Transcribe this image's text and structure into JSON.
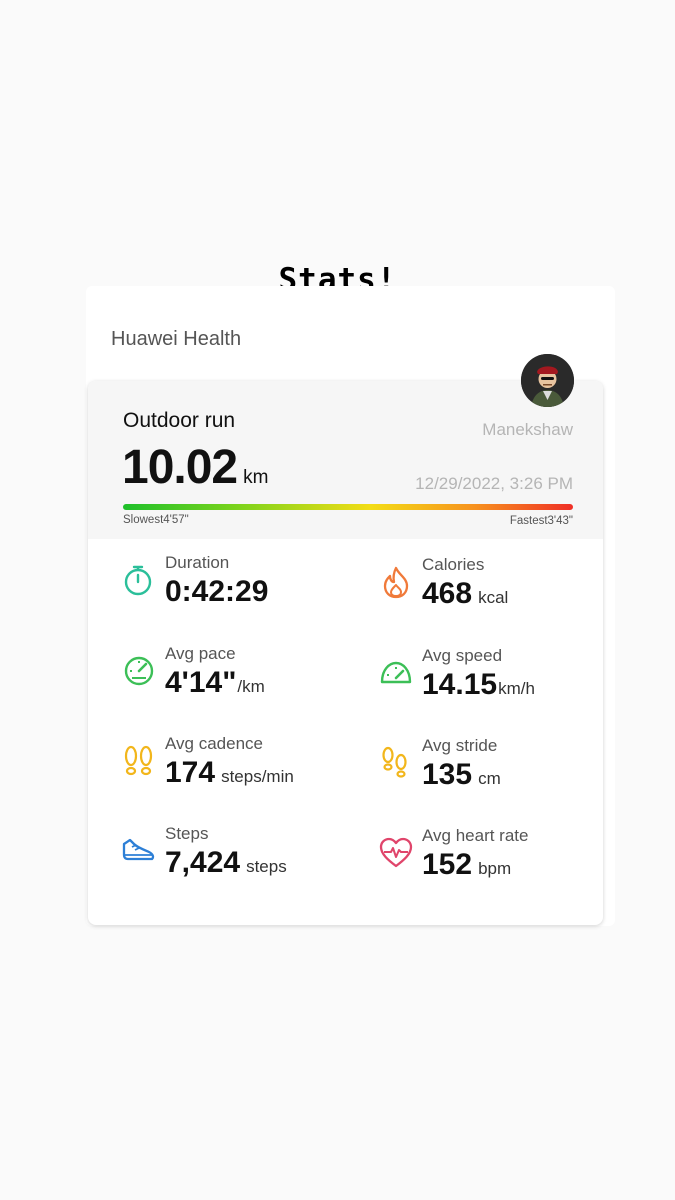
{
  "overlay_title": "Stats!",
  "app": {
    "name": "Huawei Health"
  },
  "workout": {
    "type": "Outdoor run",
    "user": "Manekshaw",
    "distance": "10.02",
    "distance_unit": "km",
    "datetime": "12/29/2022, 3:26 PM",
    "pace_bar": {
      "slowest": "Slowest4'57\"",
      "fastest": "Fastest3'43\""
    }
  },
  "metrics": {
    "duration": {
      "label": "Duration",
      "value": "0:42:29",
      "unit": ""
    },
    "calories": {
      "label": "Calories",
      "value": "468",
      "unit": "kcal"
    },
    "avg_pace": {
      "label": "Avg pace",
      "value": "4'14\"",
      "unit": "/km"
    },
    "avg_speed": {
      "label": "Avg speed",
      "value": "14.15",
      "unit": "km/h"
    },
    "avg_cadence": {
      "label": "Avg cadence",
      "value": "174",
      "unit": "steps/min"
    },
    "avg_stride": {
      "label": "Avg stride",
      "value": "135",
      "unit": "cm"
    },
    "steps": {
      "label": "Steps",
      "value": "7,424",
      "unit": "steps"
    },
    "avg_heart_rate": {
      "label": "Avg heart rate",
      "value": "152",
      "unit": "bpm"
    }
  },
  "icons": {
    "duration": "stopwatch-icon",
    "calories": "flame-icon",
    "avg_pace": "speedometer-icon",
    "avg_speed": "speedometer-icon",
    "avg_cadence": "footprints-icon",
    "avg_stride": "footprints-icon",
    "steps": "running-shoe-icon",
    "avg_heart_rate": "heart-rate-icon"
  },
  "colors": {
    "duration": "#2bbf9a",
    "calories": "#f07a3a",
    "pace": "#3cbf57",
    "cadence": "#f2b61b",
    "steps": "#2d7fd6",
    "heart": "#e0456b"
  }
}
